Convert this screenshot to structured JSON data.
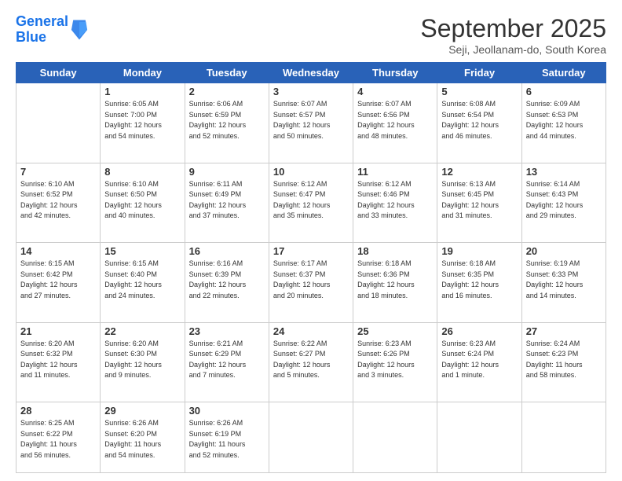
{
  "logo": {
    "line1": "General",
    "line2": "Blue"
  },
  "title": "September 2025",
  "subtitle": "Seji, Jeollanam-do, South Korea",
  "days_header": [
    "Sunday",
    "Monday",
    "Tuesday",
    "Wednesday",
    "Thursday",
    "Friday",
    "Saturday"
  ],
  "weeks": [
    [
      {
        "day": "",
        "info": ""
      },
      {
        "day": "1",
        "info": "Sunrise: 6:05 AM\nSunset: 7:00 PM\nDaylight: 12 hours\nand 54 minutes."
      },
      {
        "day": "2",
        "info": "Sunrise: 6:06 AM\nSunset: 6:59 PM\nDaylight: 12 hours\nand 52 minutes."
      },
      {
        "day": "3",
        "info": "Sunrise: 6:07 AM\nSunset: 6:57 PM\nDaylight: 12 hours\nand 50 minutes."
      },
      {
        "day": "4",
        "info": "Sunrise: 6:07 AM\nSunset: 6:56 PM\nDaylight: 12 hours\nand 48 minutes."
      },
      {
        "day": "5",
        "info": "Sunrise: 6:08 AM\nSunset: 6:54 PM\nDaylight: 12 hours\nand 46 minutes."
      },
      {
        "day": "6",
        "info": "Sunrise: 6:09 AM\nSunset: 6:53 PM\nDaylight: 12 hours\nand 44 minutes."
      }
    ],
    [
      {
        "day": "7",
        "info": "Sunrise: 6:10 AM\nSunset: 6:52 PM\nDaylight: 12 hours\nand 42 minutes."
      },
      {
        "day": "8",
        "info": "Sunrise: 6:10 AM\nSunset: 6:50 PM\nDaylight: 12 hours\nand 40 minutes."
      },
      {
        "day": "9",
        "info": "Sunrise: 6:11 AM\nSunset: 6:49 PM\nDaylight: 12 hours\nand 37 minutes."
      },
      {
        "day": "10",
        "info": "Sunrise: 6:12 AM\nSunset: 6:47 PM\nDaylight: 12 hours\nand 35 minutes."
      },
      {
        "day": "11",
        "info": "Sunrise: 6:12 AM\nSunset: 6:46 PM\nDaylight: 12 hours\nand 33 minutes."
      },
      {
        "day": "12",
        "info": "Sunrise: 6:13 AM\nSunset: 6:45 PM\nDaylight: 12 hours\nand 31 minutes."
      },
      {
        "day": "13",
        "info": "Sunrise: 6:14 AM\nSunset: 6:43 PM\nDaylight: 12 hours\nand 29 minutes."
      }
    ],
    [
      {
        "day": "14",
        "info": "Sunrise: 6:15 AM\nSunset: 6:42 PM\nDaylight: 12 hours\nand 27 minutes."
      },
      {
        "day": "15",
        "info": "Sunrise: 6:15 AM\nSunset: 6:40 PM\nDaylight: 12 hours\nand 24 minutes."
      },
      {
        "day": "16",
        "info": "Sunrise: 6:16 AM\nSunset: 6:39 PM\nDaylight: 12 hours\nand 22 minutes."
      },
      {
        "day": "17",
        "info": "Sunrise: 6:17 AM\nSunset: 6:37 PM\nDaylight: 12 hours\nand 20 minutes."
      },
      {
        "day": "18",
        "info": "Sunrise: 6:18 AM\nSunset: 6:36 PM\nDaylight: 12 hours\nand 18 minutes."
      },
      {
        "day": "19",
        "info": "Sunrise: 6:18 AM\nSunset: 6:35 PM\nDaylight: 12 hours\nand 16 minutes."
      },
      {
        "day": "20",
        "info": "Sunrise: 6:19 AM\nSunset: 6:33 PM\nDaylight: 12 hours\nand 14 minutes."
      }
    ],
    [
      {
        "day": "21",
        "info": "Sunrise: 6:20 AM\nSunset: 6:32 PM\nDaylight: 12 hours\nand 11 minutes."
      },
      {
        "day": "22",
        "info": "Sunrise: 6:20 AM\nSunset: 6:30 PM\nDaylight: 12 hours\nand 9 minutes."
      },
      {
        "day": "23",
        "info": "Sunrise: 6:21 AM\nSunset: 6:29 PM\nDaylight: 12 hours\nand 7 minutes."
      },
      {
        "day": "24",
        "info": "Sunrise: 6:22 AM\nSunset: 6:27 PM\nDaylight: 12 hours\nand 5 minutes."
      },
      {
        "day": "25",
        "info": "Sunrise: 6:23 AM\nSunset: 6:26 PM\nDaylight: 12 hours\nand 3 minutes."
      },
      {
        "day": "26",
        "info": "Sunrise: 6:23 AM\nSunset: 6:24 PM\nDaylight: 12 hours\nand 1 minute."
      },
      {
        "day": "27",
        "info": "Sunrise: 6:24 AM\nSunset: 6:23 PM\nDaylight: 11 hours\nand 58 minutes."
      }
    ],
    [
      {
        "day": "28",
        "info": "Sunrise: 6:25 AM\nSunset: 6:22 PM\nDaylight: 11 hours\nand 56 minutes."
      },
      {
        "day": "29",
        "info": "Sunrise: 6:26 AM\nSunset: 6:20 PM\nDaylight: 11 hours\nand 54 minutes."
      },
      {
        "day": "30",
        "info": "Sunrise: 6:26 AM\nSunset: 6:19 PM\nDaylight: 11 hours\nand 52 minutes."
      },
      {
        "day": "",
        "info": ""
      },
      {
        "day": "",
        "info": ""
      },
      {
        "day": "",
        "info": ""
      },
      {
        "day": "",
        "info": ""
      }
    ]
  ]
}
